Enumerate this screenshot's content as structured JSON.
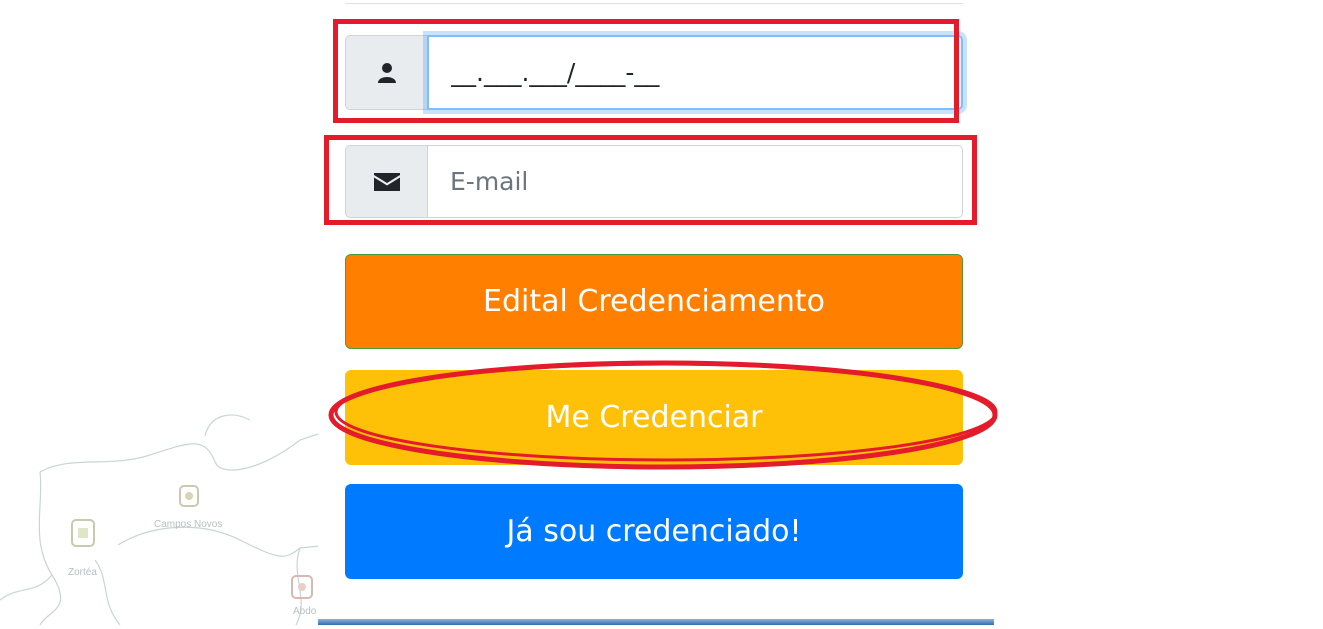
{
  "background_map": {
    "place_1": "Campos Novos",
    "place_2": "Zortéa",
    "place_3": "Abdo"
  },
  "cpf_field": {
    "icon": "user-icon",
    "value": "__.___.___/____-__"
  },
  "email_field": {
    "icon": "envelope-icon",
    "placeholder": "E-mail"
  },
  "buttons": {
    "edital": "Edital Credenciamento",
    "credenciar": "Me Credenciar",
    "ja_credenciado": "Já sou credenciado!"
  },
  "colors": {
    "edital_bg": "#ff8000",
    "edital_border": "#4a9a3a",
    "credenciar_bg": "#ffc107",
    "ja_credenciado_bg": "#007bff",
    "annotation": "#e31b2a",
    "focus_ring": "#80bdff"
  }
}
